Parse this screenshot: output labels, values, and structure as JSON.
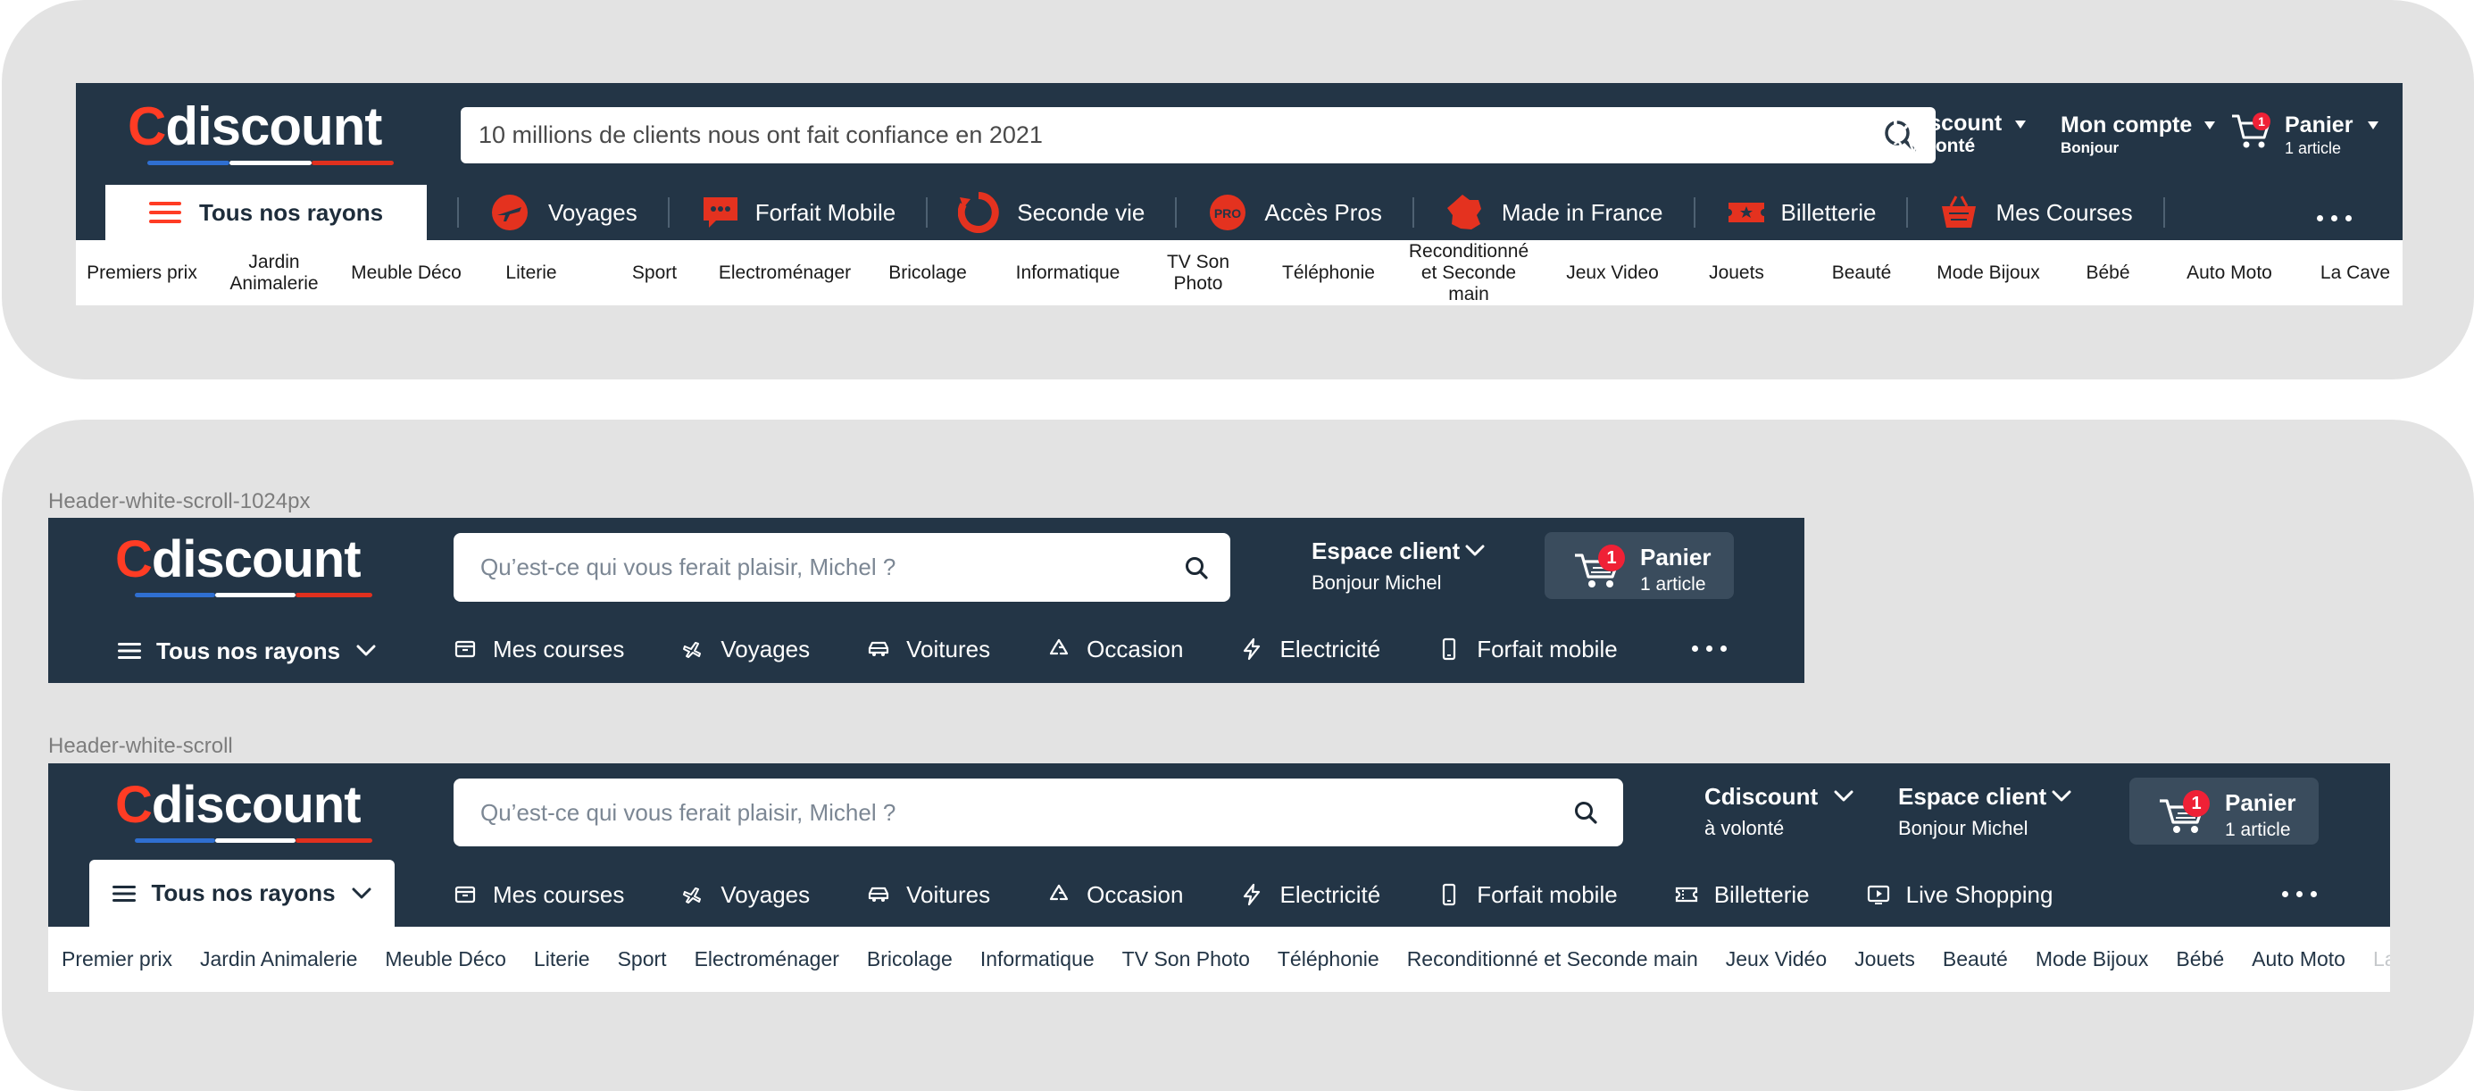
{
  "header1": {
    "logo": {
      "c": "C",
      "rest": "discount"
    },
    "search_placeholder": "10 millions de clients nous ont fait confiance en 2021",
    "cdav": {
      "line1": "Cdiscount",
      "line2": "à volonté"
    },
    "account": {
      "line1": "Mon compte",
      "line2": "Bonjour"
    },
    "cart": {
      "line1": "Panier",
      "line2": "1 article",
      "badge": "1"
    },
    "rayons": "Tous nos rayons",
    "nav": [
      "Voyages",
      "Forfait Mobile",
      "Seconde vie",
      "Accès Pros",
      "Made in France",
      "Billetterie",
      "Mes Courses"
    ],
    "categories": [
      "Premiers prix",
      "Jardin Animalerie",
      "Meuble Déco",
      "Literie",
      "Sport",
      "Electroménager",
      "Bricolage",
      "Informatique",
      "TV Son Photo",
      "Téléphonie",
      "Reconditionné et Seconde main",
      "Jeux Video",
      "Jouets",
      "Beauté",
      "Mode Bijoux",
      "Bébé",
      "Auto Moto",
      "La Cave"
    ]
  },
  "header2": {
    "caption": "Header-white-scroll-1024px",
    "logo": {
      "c": "C",
      "rest": "discount"
    },
    "search_placeholder": "Qu’est-ce qui vous ferait plaisir, Michel ?",
    "account": {
      "line1": "Espace client",
      "line2": "Bonjour Michel"
    },
    "cart": {
      "line1": "Panier",
      "line2": "1 article",
      "badge": "1"
    },
    "rayons": "Tous nos rayons",
    "nav": [
      "Mes courses",
      "Voyages",
      "Voitures",
      "Occasion",
      "Electricité",
      "Forfait mobile"
    ]
  },
  "header3": {
    "caption": "Header-white-scroll",
    "logo": {
      "c": "C",
      "rest": "discount"
    },
    "search_placeholder": "Qu’est-ce qui vous ferait plaisir, Michel ?",
    "cdav": {
      "line1": "Cdiscount",
      "line2": "à volonté"
    },
    "account": {
      "line1": "Espace client",
      "line2": "Bonjour Michel"
    },
    "cart": {
      "line1": "Panier",
      "line2": "1 article",
      "badge": "1"
    },
    "rayons": "Tous nos rayons",
    "nav": [
      "Mes courses",
      "Voyages",
      "Voitures",
      "Occasion",
      "Electricité",
      "Forfait mobile",
      "Billetterie",
      "Live Shopping"
    ],
    "categories": [
      "Premier prix",
      "Jardin Animalerie",
      "Meuble Déco",
      "Literie",
      "Sport",
      "Electroménager",
      "Bricolage",
      "Informatique",
      "TV Son Photo",
      "Téléphonie",
      "Reconditionné et Seconde main",
      "Jeux Vidéo",
      "Jouets",
      "Beauté",
      "Mode Bijoux",
      "Bébé",
      "Auto Moto",
      "La Cave"
    ]
  },
  "colors": {
    "brand_red": "#ff3c24",
    "header_bg": "#233546",
    "badge_red": "#ef2136",
    "underline_blue": "#2f6fd1"
  }
}
